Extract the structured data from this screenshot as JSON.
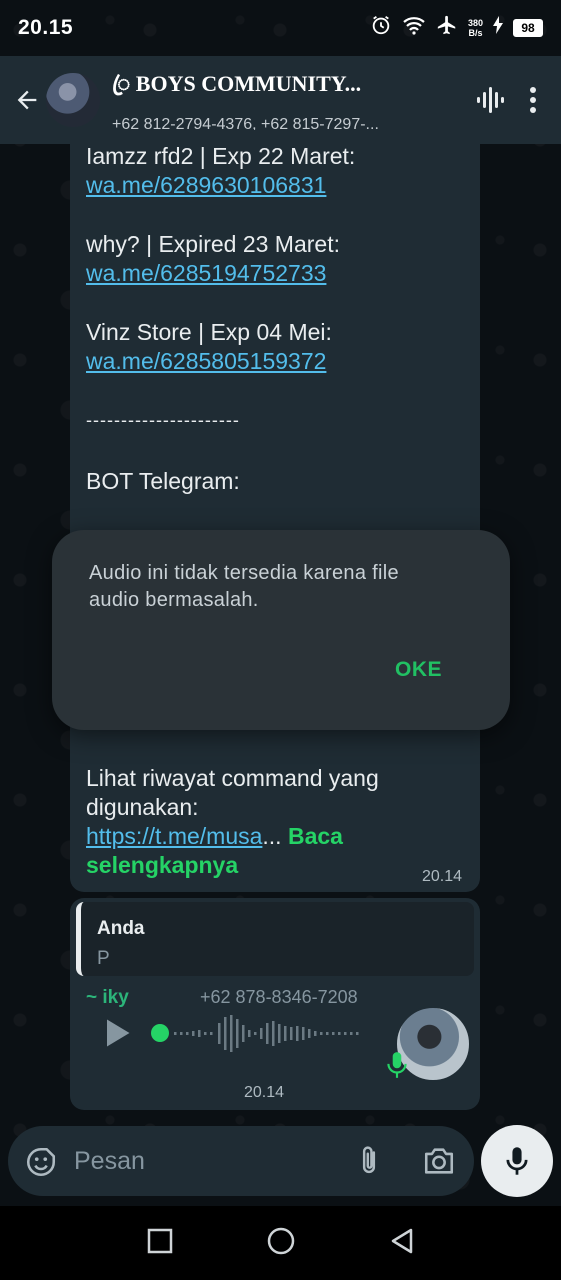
{
  "status_bar": {
    "time": "20.15",
    "net_speed_value": "380",
    "net_speed_unit": "B/s",
    "battery": "98",
    "icons": [
      "alarm-icon",
      "wifi-icon",
      "airplane-icon",
      "charging-icon",
      "battery-icon"
    ]
  },
  "header": {
    "title": "ꦿ BOYS COMMUNITY...",
    "subtitle": "+62 812-2794-4376, +62 815-7297-...",
    "icons": [
      "back-arrow-icon",
      "voice-chat-icon",
      "more-vert-icon"
    ]
  },
  "message_1": {
    "lines": [
      {
        "text": "Iamzz rfd2 | Exp 22 Maret:",
        "type": "text"
      },
      {
        "text": "wa.me/6289630106831",
        "type": "link"
      },
      {
        "text": "why? | Expired 23 Maret:",
        "type": "text"
      },
      {
        "text": "wa.me/6285194752733",
        "type": "link"
      },
      {
        "text": "Vinz Store | Exp 04 Mei:",
        "type": "text"
      },
      {
        "text": "wa.me/6285805159372",
        "type": "link"
      },
      {
        "text": "----------------------",
        "type": "text"
      },
      {
        "text": "BOT Telegram:",
        "type": "text"
      },
      {
        "text": "Lihat riwayat command yang",
        "type": "text"
      },
      {
        "text": "digunakan:",
        "type": "text"
      }
    ],
    "final_link": "https://t.me/musa",
    "ellipsis": "...",
    "read_more_1": "Baca",
    "read_more_2": "selengkapnya",
    "time": "20.14"
  },
  "message_2": {
    "quote_author": "Anda",
    "quote_text": "P",
    "sender_name": "~ iky",
    "sender_phone": "+62 878-8346-7208",
    "time": "20.14",
    "audio_progress": 0.0
  },
  "dialog": {
    "message": "Audio ini tidak tersedia karena file audio bermasalah.",
    "ok_label": "OKE"
  },
  "composer": {
    "placeholder": "Pesan",
    "icons": [
      "emoji-icon",
      "attach-icon",
      "camera-icon",
      "mic-icon"
    ]
  },
  "colors": {
    "background": "#0b1014",
    "bubble": "#1f2c34",
    "link": "#53bdeb",
    "accent_green": "#25d366",
    "dialog_bg": "#2a3237"
  }
}
